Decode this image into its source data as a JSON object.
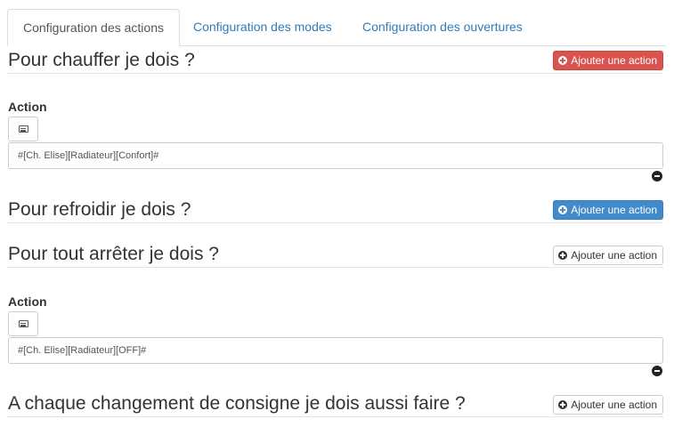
{
  "tabs": [
    {
      "label": "Configuration des actions",
      "active": true
    },
    {
      "label": "Configuration des modes",
      "active": false
    },
    {
      "label": "Configuration des ouvertures",
      "active": false
    }
  ],
  "sections": {
    "heat": {
      "title": "Pour chauffer je dois ?",
      "add_label": "Ajouter une action",
      "add_color": "#d9534f"
    },
    "cool": {
      "title": "Pour refroidir je dois ?",
      "add_label": "Ajouter une action",
      "add_color": "#428bca"
    },
    "stop": {
      "title": "Pour tout arrêter je dois ?",
      "add_label": "Ajouter une action",
      "add_color": "#ffffff"
    },
    "setpoint": {
      "title": "A chaque changement de consigne je dois aussi faire ?",
      "add_label": "Ajouter une action",
      "add_color": "#ffffff"
    }
  },
  "actions": {
    "heat": {
      "label": "Action",
      "value": "#[Ch. Elise][Radiateur][Confort]#"
    },
    "stop": {
      "label": "Action",
      "value": "#[Ch. Elise][Radiateur][OFF]#"
    }
  },
  "icons": {
    "add": "plus-circle-icon",
    "select": "list-alt-icon",
    "remove": "minus-circle-icon"
  }
}
